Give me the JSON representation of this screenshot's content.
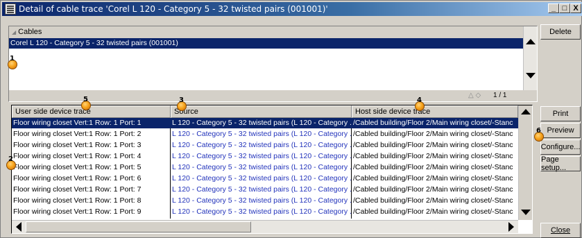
{
  "window": {
    "title": "Detail of cable trace 'Corel L 120 - Category 5 - 32 twisted pairs (001001)'",
    "minimize_label": "_",
    "maximize_label": "□",
    "close_label": "X"
  },
  "cables_list": {
    "header": "Cables",
    "rows": [
      "Corel L 120 - Category 5 - 32 twisted pairs (001001)"
    ],
    "pager": "1 / 1"
  },
  "buttons": {
    "delete": "Delete",
    "print": "Print",
    "preview": "Preview",
    "configure": "Configure...",
    "page_setup": "Page setup...",
    "close": "Close"
  },
  "trace_table": {
    "columns": [
      "User side device trace",
      "Source",
      "Host side device trace"
    ],
    "rows": [
      [
        "Floor wiring closet Vert:1 Row: 1 Port: 1",
        "L 120 - Category 5 - 32 twisted pairs (L 120 - Category ...",
        "/Cabled building/Floor 2/Main wiring closet/-Stanc"
      ],
      [
        "Floor wiring closet Vert:1 Row: 1 Port: 2",
        "L 120 - Category 5 - 32 twisted pairs (L 120 - Category ...",
        "/Cabled building/Floor 2/Main wiring closet/-Stanc"
      ],
      [
        "Floor wiring closet Vert:1 Row: 1 Port: 3",
        "L 120 - Category 5 - 32 twisted pairs (L 120 - Category ...",
        "/Cabled building/Floor 2/Main wiring closet/-Stanc"
      ],
      [
        "Floor wiring closet Vert:1 Row: 1 Port: 4",
        "L 120 - Category 5 - 32 twisted pairs (L 120 - Category ...",
        "/Cabled building/Floor 2/Main wiring closet/-Stanc"
      ],
      [
        "Floor wiring closet Vert:1 Row: 1 Port: 5",
        "L 120 - Category 5 - 32 twisted pairs (L 120 - Category ...",
        "/Cabled building/Floor 2/Main wiring closet/-Stanc"
      ],
      [
        "Floor wiring closet Vert:1 Row: 1 Port: 6",
        "L 120 - Category 5 - 32 twisted pairs (L 120 - Category ...",
        "/Cabled building/Floor 2/Main wiring closet/-Stanc"
      ],
      [
        "Floor wiring closet Vert:1 Row: 1 Port: 7",
        "L 120 - Category 5 - 32 twisted pairs (L 120 - Category ...",
        "/Cabled building/Floor 2/Main wiring closet/-Stanc"
      ],
      [
        "Floor wiring closet Vert:1 Row: 1 Port: 8",
        "L 120 - Category 5 - 32 twisted pairs (L 120 - Category ...",
        "/Cabled building/Floor 2/Main wiring closet/-Stanc"
      ],
      [
        "Floor wiring closet Vert:1 Row: 1 Port: 9",
        "L 120 - Category 5 - 32 twisted pairs (L 120 - Category ...",
        "/Cabled building/Floor 2/Main wiring closet/-Stanc"
      ]
    ]
  },
  "callouts": [
    "1",
    "2",
    "3",
    "4",
    "5",
    "6"
  ],
  "colors": {
    "title_gradient_start": "#0a246a",
    "selection": "#0a246a",
    "link_text": "#2233bb",
    "callout": "#f7a51c"
  }
}
